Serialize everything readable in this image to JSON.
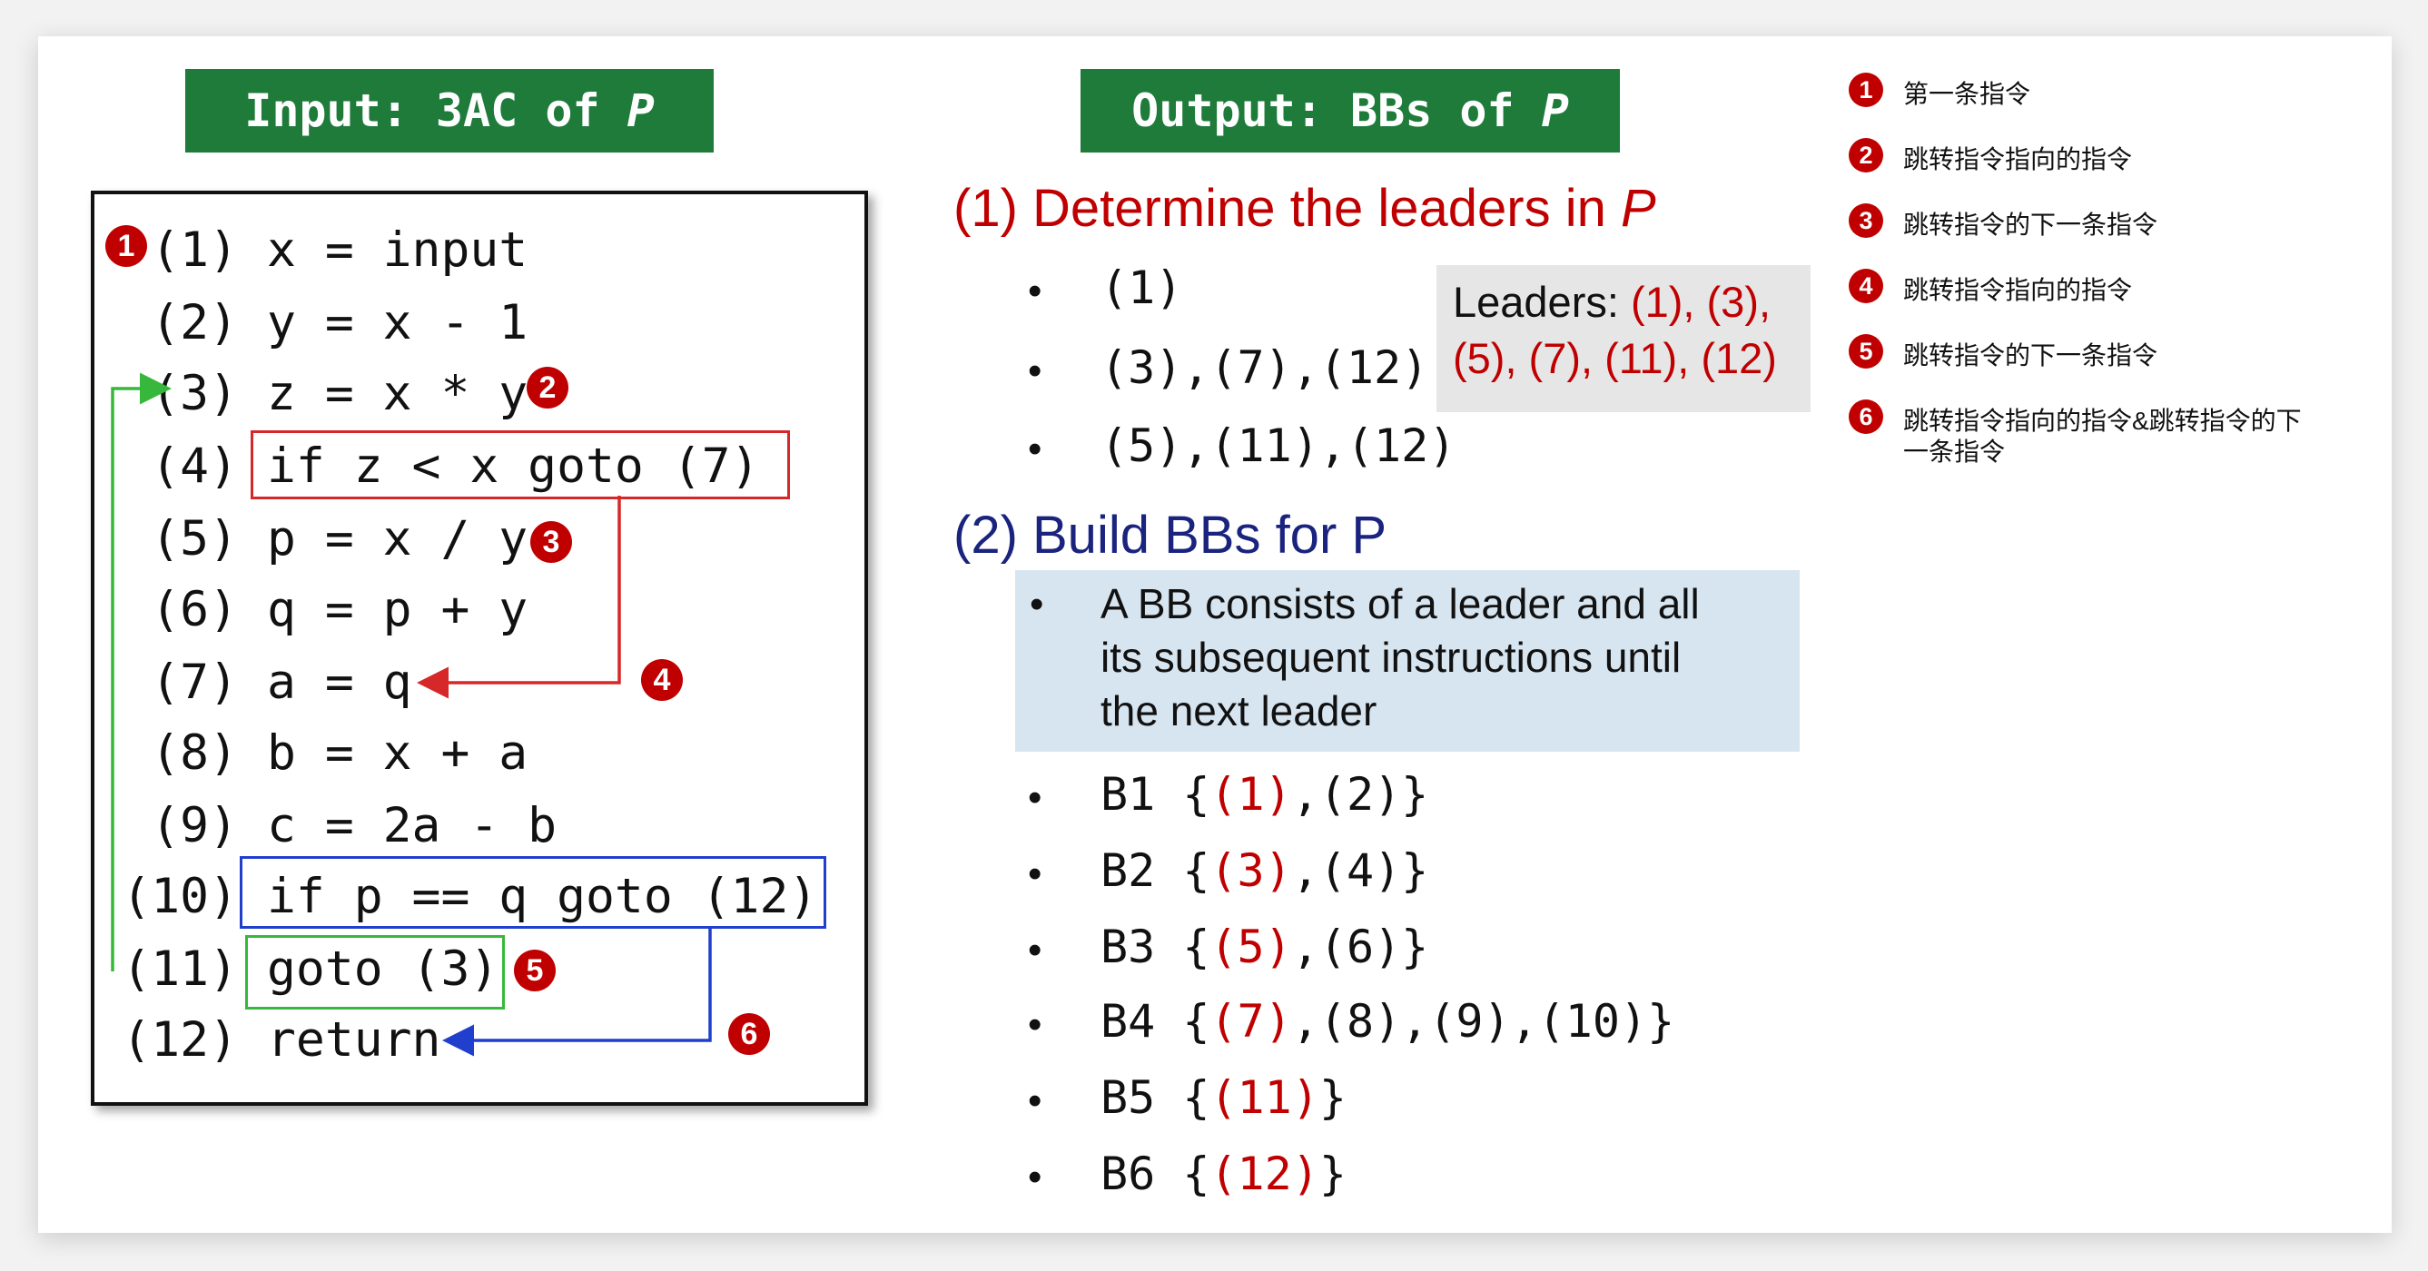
{
  "input_banner": {
    "label": "Input: 3AC of ",
    "var": "P"
  },
  "output_banner": {
    "label": "Output: BBs of ",
    "var": "P"
  },
  "code": [
    {
      "num": "(1)",
      "text": "x = input"
    },
    {
      "num": "(2)",
      "text": "y = x - 1"
    },
    {
      "num": "(3)",
      "text": "z = x * y"
    },
    {
      "num": "(4)",
      "text": "if z < x goto (7)"
    },
    {
      "num": "(5)",
      "text": "p = x / y"
    },
    {
      "num": "(6)",
      "text": "q = p + y"
    },
    {
      "num": "(7)",
      "text": "a = q"
    },
    {
      "num": "(8)",
      "text": "b = x + a"
    },
    {
      "num": "(9)",
      "text": "c = 2a - b"
    },
    {
      "num": "(10)",
      "text": "if p == q goto (12)"
    },
    {
      "num": "(11)",
      "text": "goto (3)"
    },
    {
      "num": "(12)",
      "text": "return"
    }
  ],
  "markers": [
    "1",
    "2",
    "3",
    "4",
    "5",
    "6"
  ],
  "step1": {
    "prefix": "(1) Determine the leaders in ",
    "var": "P",
    "items": [
      "(1)",
      "(3),(7),(12)",
      "(5),(11),(12)"
    ]
  },
  "leaders_box": {
    "label": "Leaders: ",
    "line1": "(1), (3),",
    "line2": "(5), (7), (11), (12)"
  },
  "step2": {
    "title": "(2) Build BBs for P",
    "definition_line1": "A BB consists of a leader and all",
    "definition_line2": "its subsequent instructions until",
    "definition_line3": "the next leader"
  },
  "blocks": [
    {
      "name": "B1",
      "leader": "(1)",
      "rest": ",(2)"
    },
    {
      "name": "B2",
      "leader": "(3)",
      "rest": ",(4)"
    },
    {
      "name": "B3",
      "leader": "(5)",
      "rest": ",(6)"
    },
    {
      "name": "B4",
      "leader": "(7)",
      "rest": ",(8),(9),(10)"
    },
    {
      "name": "B5",
      "leader": "(11)",
      "rest": ""
    },
    {
      "name": "B6",
      "leader": "(12)",
      "rest": ""
    }
  ],
  "legend": [
    {
      "num": "1",
      "text": "第一条指令"
    },
    {
      "num": "2",
      "text": "跳转指令指向的指令"
    },
    {
      "num": "3",
      "text": "跳转指令的下一条指令"
    },
    {
      "num": "4",
      "text": "跳转指令指向的指令"
    },
    {
      "num": "5",
      "text": "跳转指令的下一条指令"
    },
    {
      "num": "6",
      "text": "跳转指令指向的指令&跳转指令的下",
      "text2": "一条指令"
    }
  ],
  "colors": {
    "banner": "#1e7b3a",
    "accent_red": "#c00000",
    "heading_blue": "#1a237e",
    "box_red": "#d62828",
    "box_blue": "#1f3fcc",
    "box_green": "#37b83c",
    "leaders_bg": "#e6e6e6",
    "definition_bg": "#d7e5f0"
  }
}
